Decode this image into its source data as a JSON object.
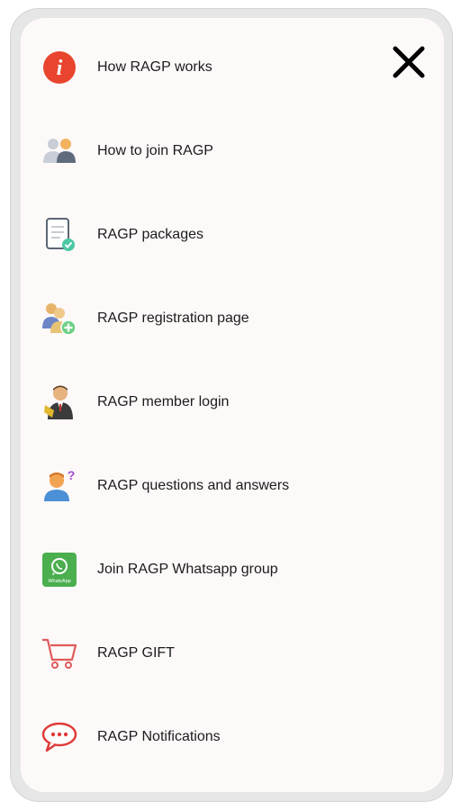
{
  "menu": {
    "items": [
      {
        "id": "how-ragp-works",
        "label": "How RAGP works",
        "icon": "info-icon"
      },
      {
        "id": "how-to-join",
        "label": "How to join RAGP",
        "icon": "users-icon"
      },
      {
        "id": "packages",
        "label": "RAGP packages",
        "icon": "document-check-icon"
      },
      {
        "id": "registration",
        "label": "RAGP registration page",
        "icon": "add-user-icon"
      },
      {
        "id": "member-login",
        "label": "RAGP member login",
        "icon": "member-login-icon"
      },
      {
        "id": "qa",
        "label": "RAGP questions and answers",
        "icon": "question-user-icon"
      },
      {
        "id": "whatsapp",
        "label": "Join RAGP Whatsapp group",
        "icon": "whatsapp-icon"
      },
      {
        "id": "gift",
        "label": "RAGP GIFT",
        "icon": "cart-icon"
      },
      {
        "id": "notifications",
        "label": "RAGP Notifications",
        "icon": "chat-bubble-icon"
      }
    ],
    "close_icon": "close-icon",
    "whatsapp_badge_text": "WhatsApp"
  },
  "colors": {
    "info_red": "#e8442e",
    "whatsapp_green": "#4bae4f",
    "cart_red": "#e05a5a",
    "check_teal": "#4cc7a3",
    "background": "#fdf9f9"
  }
}
